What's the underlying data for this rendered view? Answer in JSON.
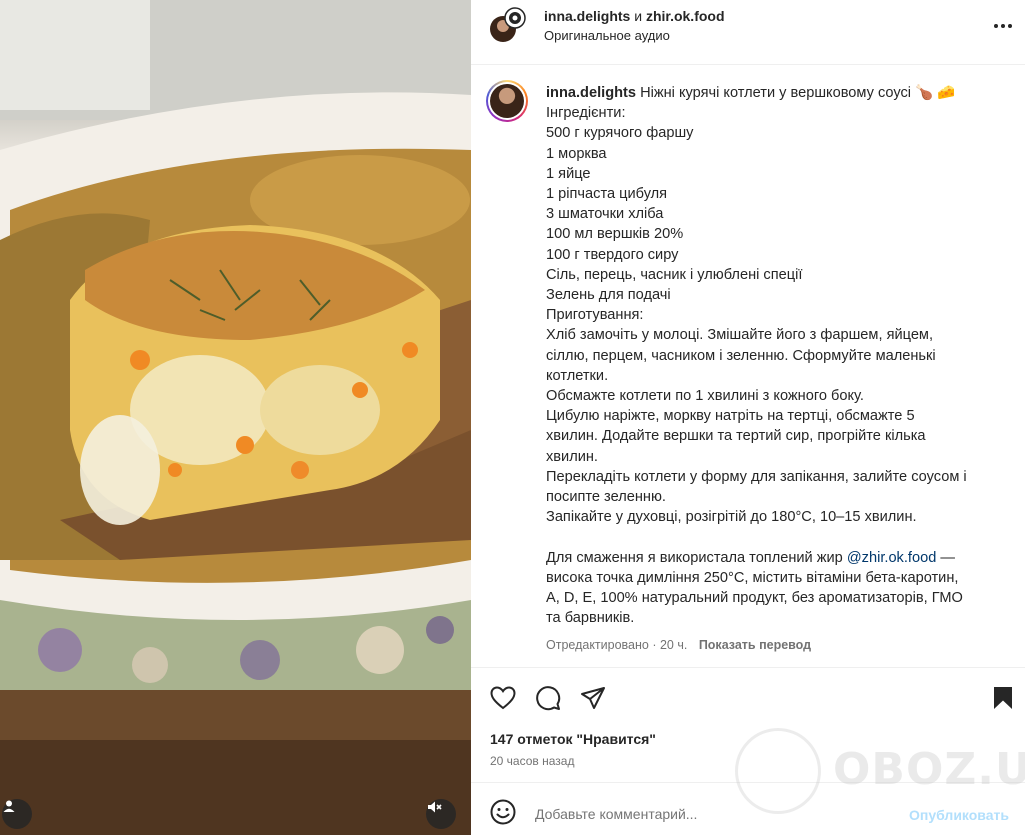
{
  "header": {
    "author1": "inna.delights",
    "conjunction": "и",
    "author2": "zhir.ok.food",
    "audio": "Оригинальное аудио"
  },
  "caption": {
    "username": "inna.delights",
    "title": "Ніжні курячі котлети у вершковому соусі 🍗 🧀",
    "lines": [
      "Інгредієнти:",
      "500 г курячого фаршу",
      "1 морква",
      "1 яйце",
      "1 ріпчаста цибуля",
      "3 шматочки хліба",
      "100 мл вершків 20%",
      "100 г твердого сиру",
      "Сіль, перець, часник і улюблені спеції",
      "Зелень для подачі",
      "Приготування:",
      "Хліб замочіть у молоці. Змішайте його з фаршем, яйцем,",
      "сіллю, перцем, часником і зеленню. Сформуйте маленькі",
      "котлетки.",
      "Обсмажте котлети по 1 хвилині з кожного боку.",
      "Цибулю наріжте, моркву натріть на тертці, обсмажте 5",
      "хвилин. Додайте вершки та тертий сир, прогрійте кілька",
      "хвилин.",
      "Перекладіть котлети у форму для запікання, залийте соусом і",
      "посипте зеленню.",
      "Запікайте у духовці, розігрітій до 180°C, 10–15 хвилин."
    ],
    "footer_prefix": "Для смаження я використала топлений жир ",
    "footer_mention": "@zhir.ok.food",
    "footer_suffix": " —",
    "footer_lines": [
      "висока точка димління 250°C, містить вітаміни бета-каротин,",
      "A, D, E, 100% натуральний продукт, без ароматизаторів, ГМО",
      "та барвників."
    ],
    "edited": "Отредактировано · 20 ч.",
    "translate": "Показать перевод"
  },
  "likes": "147 отметок \"Нравится\"",
  "time": "20 часов назад",
  "comment": {
    "placeholder": "Добавьте комментарий...",
    "post": "Опубликовать"
  },
  "watermark": "OBOZ.UA",
  "icons": {
    "like": "heart-icon",
    "comment": "comment-icon",
    "share": "paper-plane-icon",
    "save": "bookmark-icon",
    "more": "more-horizontal-icon",
    "emoji": "smiley-icon",
    "mute": "speaker-muted-icon",
    "tags": "user-tag-icon"
  },
  "colors": {
    "mention": "#00376b",
    "post_disabled": "#b2dffc",
    "secondary_text": "#737373"
  }
}
